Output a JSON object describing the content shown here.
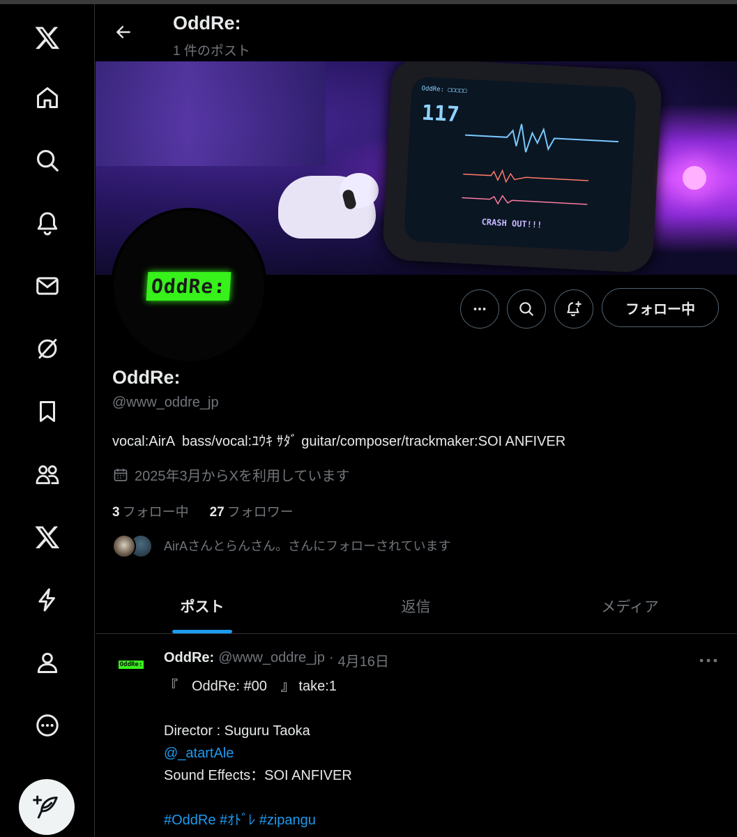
{
  "header": {
    "title": "OddRe:",
    "post_count": "1 件のポスト"
  },
  "profile": {
    "avatar_text": "OddRe:",
    "display_name": "OddRe:",
    "handle": "@www_oddre_jp",
    "bio": "vocal:AirA  bass/vocal:ﾕｳｷ ｻﾀﾞ guitar/composer/trackmaker:SOI ANFIVER",
    "joined": "2025年3月からXを利用しています",
    "following_count": "3",
    "following_label": "フォロー中",
    "followers_count": "27",
    "followers_label": "フォロワー",
    "followed_by": "AirAさんとらんさん。さんにフォローされています",
    "follow_button": "フォロー中"
  },
  "banner": {
    "screen_top": "OddRe: ▢▢▢▢▢",
    "bpm": "117",
    "crash": "CRASH OUT!!!"
  },
  "tabs": [
    {
      "label": "ポスト",
      "active": true
    },
    {
      "label": "返信",
      "active": false
    },
    {
      "label": "メディア",
      "active": false
    }
  ],
  "post": {
    "name": "OddRe:",
    "handle": "@www_oddre_jp",
    "separator": "·",
    "date": "4月16日",
    "avatar_text": "OddRe:",
    "lines": {
      "l1": "『　OddRe: #00　』 take:1",
      "l2": "Director : Suguru Taoka",
      "l3": "@_atartAle",
      "l4": "Sound Effects：SOI ANFIVER",
      "l5": "#OddRe #ｵﾄﾞﾚ #zipangu"
    }
  },
  "colors": {
    "accent": "#1d9bf0",
    "logo_green": "#36f21a",
    "border": "#2f3336",
    "muted": "#71767b"
  },
  "icons": [
    "x-logo-icon",
    "home-icon",
    "search-icon",
    "bell-icon",
    "mail-icon",
    "grok-icon",
    "bookmark-icon",
    "communities-icon",
    "premium-x-icon",
    "lightning-icon",
    "profile-icon",
    "more-circle-icon",
    "compose-icon"
  ]
}
